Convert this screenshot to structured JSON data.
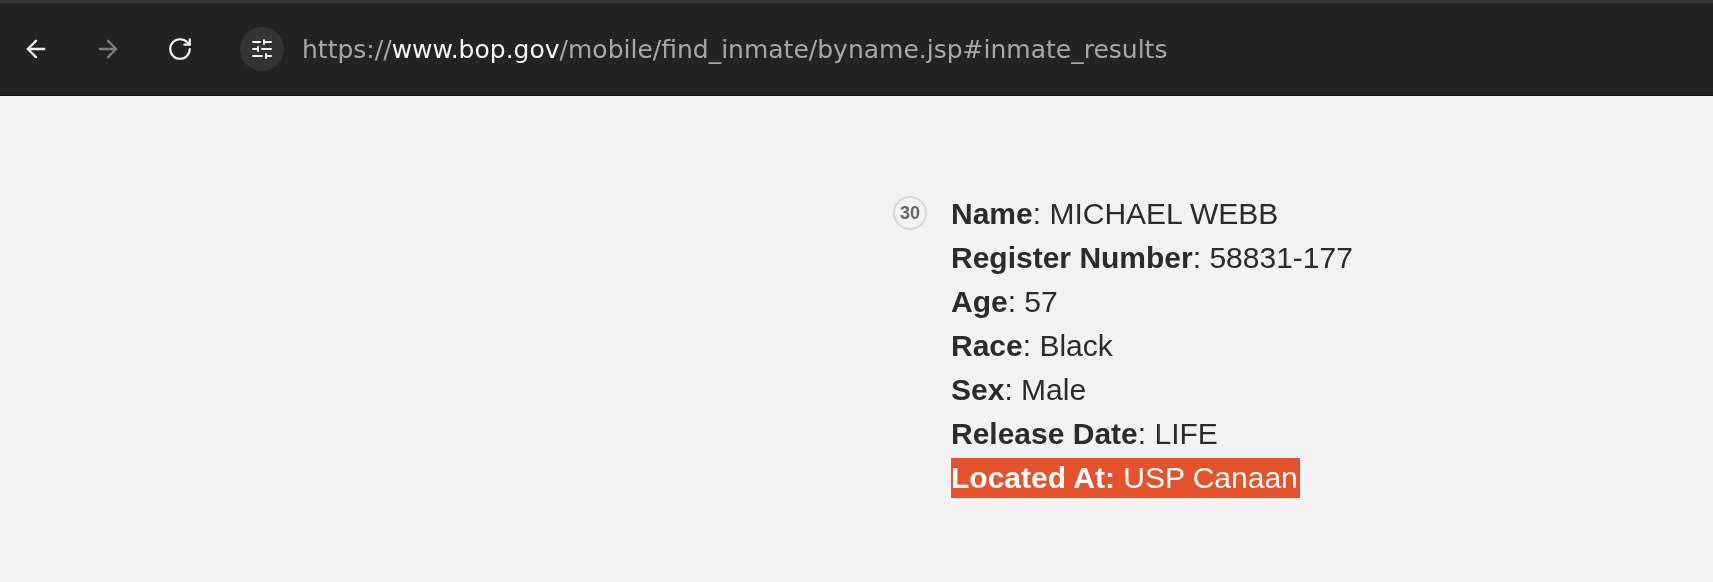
{
  "browser": {
    "back": {
      "disabled": false
    },
    "forward": {
      "disabled": true
    },
    "url": {
      "scheme": "https://",
      "host": "www.bop.gov",
      "path": "/mobile/find_inmate/byname.jsp#inmate_results"
    }
  },
  "result": {
    "number": "30",
    "lines": [
      {
        "kind": "plain",
        "text": "**Name**: MICHAEL WEBB"
      },
      {
        "kind": "plain",
        "text": "**Register Number**: 58831-177"
      },
      {
        "kind": "plain",
        "text": "**Age**: 57"
      },
      {
        "kind": "plain",
        "text": "**Race**: Black"
      },
      {
        "kind": "plain",
        "text": "**Sex**: Male"
      },
      {
        "kind": "plain",
        "text": "**Release Date**: LIFE"
      },
      {
        "kind": "highlight",
        "text": "**Located At:** USP Canaan"
      }
    ]
  }
}
